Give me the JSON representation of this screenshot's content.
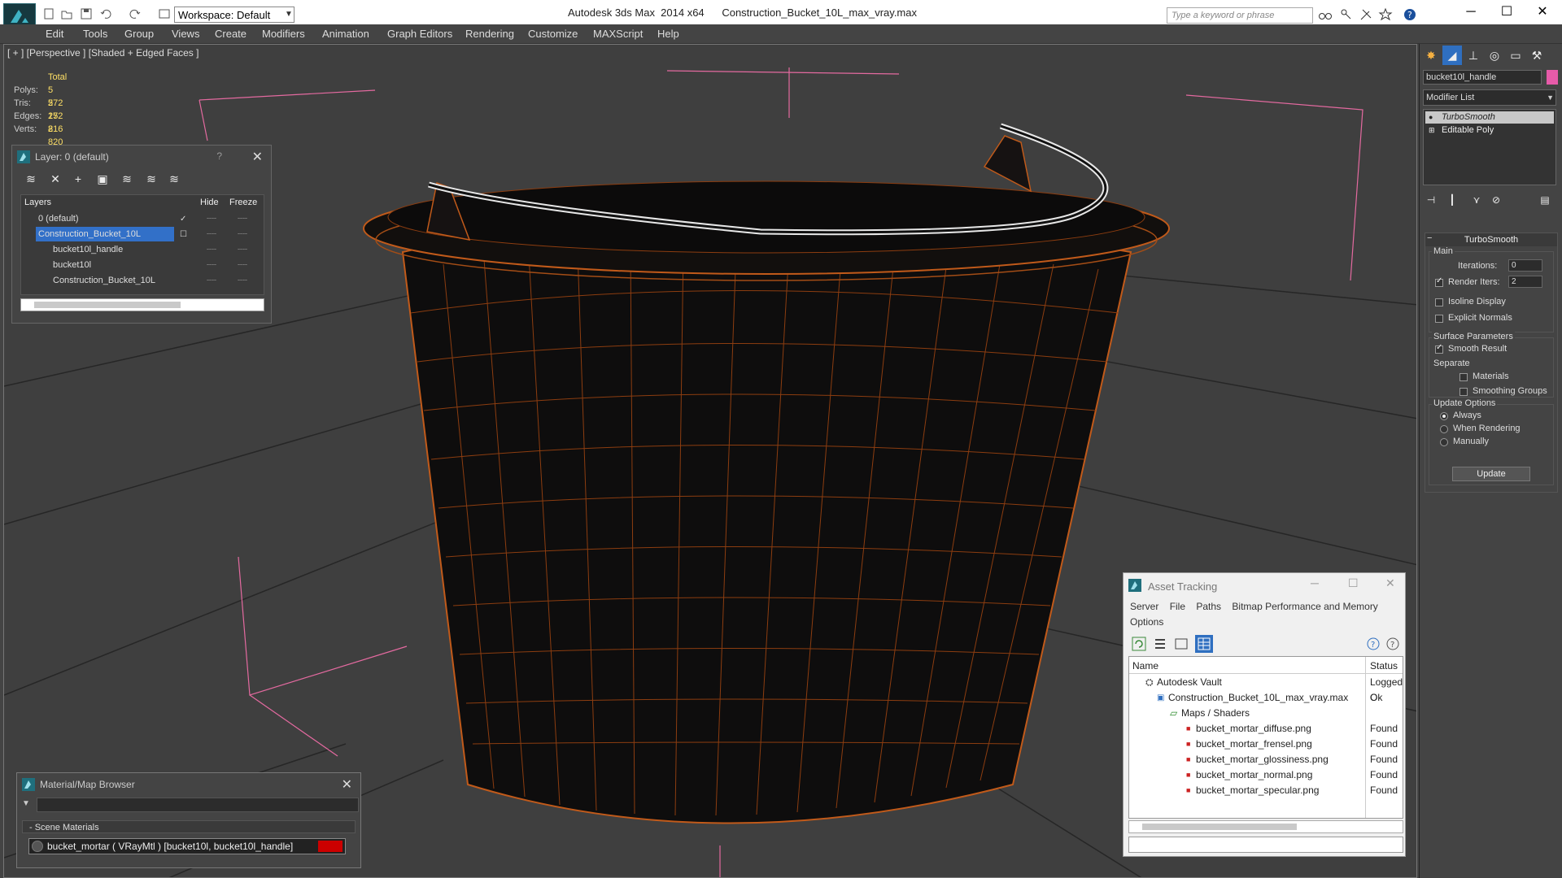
{
  "titlebar": {
    "workspace": "Workspace: Default",
    "app_title": "Autodesk 3ds Max  2014 x64      Construction_Bucket_10L_max_vray.max",
    "search_placeholder": "Type a keyword or phrase"
  },
  "menu": [
    "Edit",
    "Tools",
    "Group",
    "Views",
    "Create",
    "Modifiers",
    "Animation",
    "Graph Editors",
    "Rendering",
    "Customize",
    "MAXScript",
    "Help"
  ],
  "viewport": {
    "label": "[ + ] [Perspective ] [Shaded + Edged Faces ]",
    "stats": {
      "total_label": "Total",
      "polys_label": "Polys:",
      "polys": "5 272",
      "tris_label": "Tris:",
      "tris": "5 272",
      "edges_label": "Edges:",
      "edges": "15 816",
      "verts_label": "Verts:",
      "verts": "2 820"
    }
  },
  "layer_window": {
    "title": "Layer: 0 (default)",
    "help": "?",
    "columns": {
      "layers": "Layers",
      "hide": "Hide",
      "freeze": "Freeze"
    },
    "rows": [
      "0 (default)",
      "Construction_Bucket_10L",
      "bucket10l_handle",
      "bucket10l",
      "Construction_Bucket_10L"
    ]
  },
  "material_browser": {
    "title": "Material/Map Browser",
    "section": "- Scene Materials",
    "item": "bucket_mortar  ( VRayMtl )  [bucket10l, bucket10l_handle]"
  },
  "asset_tracking": {
    "title": "Asset Tracking",
    "menu": [
      "Server",
      "File",
      "Paths",
      "Bitmap Performance and Memory",
      "Options"
    ],
    "columns": {
      "name": "Name",
      "status": "Status"
    },
    "rows": [
      {
        "name": "Autodesk Vault",
        "status": "Logged O"
      },
      {
        "name": "Construction_Bucket_10L_max_vray.max",
        "status": "Ok"
      },
      {
        "name": "Maps / Shaders",
        "status": ""
      },
      {
        "name": "bucket_mortar_diffuse.png",
        "status": "Found"
      },
      {
        "name": "bucket_mortar_frensel.png",
        "status": "Found"
      },
      {
        "name": "bucket_mortar_glossiness.png",
        "status": "Found"
      },
      {
        "name": "bucket_mortar_normal.png",
        "status": "Found"
      },
      {
        "name": "bucket_mortar_specular.png",
        "status": "Found"
      }
    ]
  },
  "command_panel": {
    "object_name": "bucket10l_handle",
    "modifier_list": "Modifier List",
    "stack": [
      "TurboSmooth",
      "Editable Poly"
    ],
    "turbosmooth": {
      "title": "TurboSmooth",
      "main": "Main",
      "iterations_label": "Iterations:",
      "iterations": "0",
      "render_iters_label": "Render Iters:",
      "render_iters": "2",
      "isoline": "Isoline Display",
      "explicit_normals": "Explicit Normals",
      "surface_params": "Surface Parameters",
      "smooth_result": "Smooth Result",
      "separate": "Separate",
      "materials": "Materials",
      "smoothing_groups": "Smoothing Groups",
      "update_options": "Update Options",
      "always": "Always",
      "when_rendering": "When Rendering",
      "manually": "Manually",
      "update": "Update"
    }
  }
}
